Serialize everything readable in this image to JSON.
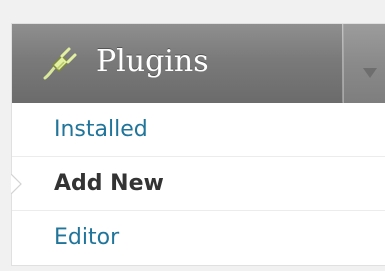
{
  "menu": {
    "title": "Plugins",
    "icon": "plug-icon",
    "toggle_icon": "triangle-down-icon",
    "items": [
      {
        "label": "Installed",
        "current": false
      },
      {
        "label": "Add New",
        "current": true
      },
      {
        "label": "Editor",
        "current": false
      }
    ]
  },
  "colors": {
    "link": "#21759b",
    "current": "#333333",
    "header": "#7a7a7a"
  }
}
